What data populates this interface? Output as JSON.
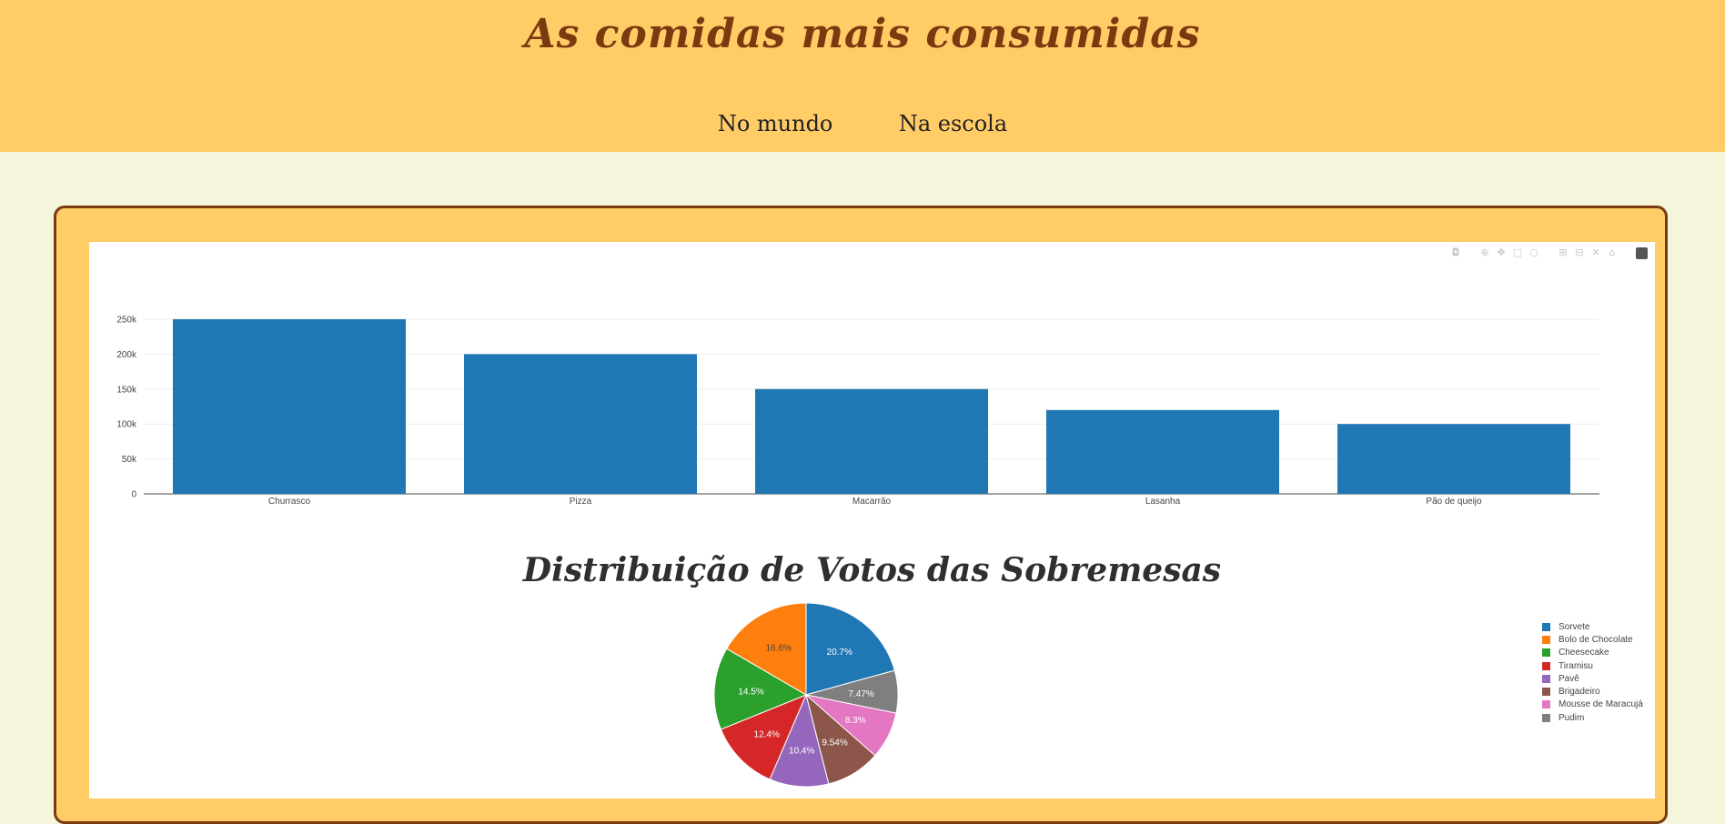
{
  "header": {
    "title": "As comidas mais consumidas",
    "nav": [
      {
        "label": "No mundo"
      },
      {
        "label": "Na escola"
      }
    ]
  },
  "modebar": {
    "icons": [
      "camera-icon",
      "zoom-icon",
      "pan-icon",
      "box-select-icon",
      "lasso-select-icon",
      "zoom-in-icon",
      "zoom-out-icon",
      "autoscale-icon",
      "reset-axes-icon",
      "plotly-logo-icon"
    ]
  },
  "chart_data": [
    {
      "type": "bar",
      "categories": [
        "Churrasco",
        "Pizza",
        "Macarrão",
        "Lasanha",
        "Pão de queijo"
      ],
      "values": [
        250000,
        200000,
        150000,
        120000,
        100000
      ],
      "yticks": [
        "0",
        "50k",
        "100k",
        "150k",
        "200k",
        "250k"
      ],
      "ylim": [
        0,
        250000
      ],
      "color": "#1f77b4",
      "grid": true
    },
    {
      "type": "pie",
      "title": "Distribuição de Votos das Sobremesas",
      "labels": [
        "Sorvete",
        "Bolo de Chocolate",
        "Cheesecake",
        "Tiramisu",
        "Pavê",
        "Brigadeiro",
        "Mousse de Maracujá",
        "Pudim"
      ],
      "values": [
        20.7,
        16.6,
        14.5,
        12.4,
        10.4,
        9.54,
        8.3,
        7.47
      ],
      "value_labels": [
        "20.7%",
        "16.6%",
        "14.5%",
        "12.4%",
        "10.4%",
        "9.54%",
        "8.3%",
        "7.47%"
      ],
      "colors": [
        "#1f77b4",
        "#ff7f0e",
        "#2ca02c",
        "#d62728",
        "#9467bd",
        "#8c564b",
        "#e377c2",
        "#7f7f7f"
      ],
      "legend_position": "right"
    }
  ]
}
